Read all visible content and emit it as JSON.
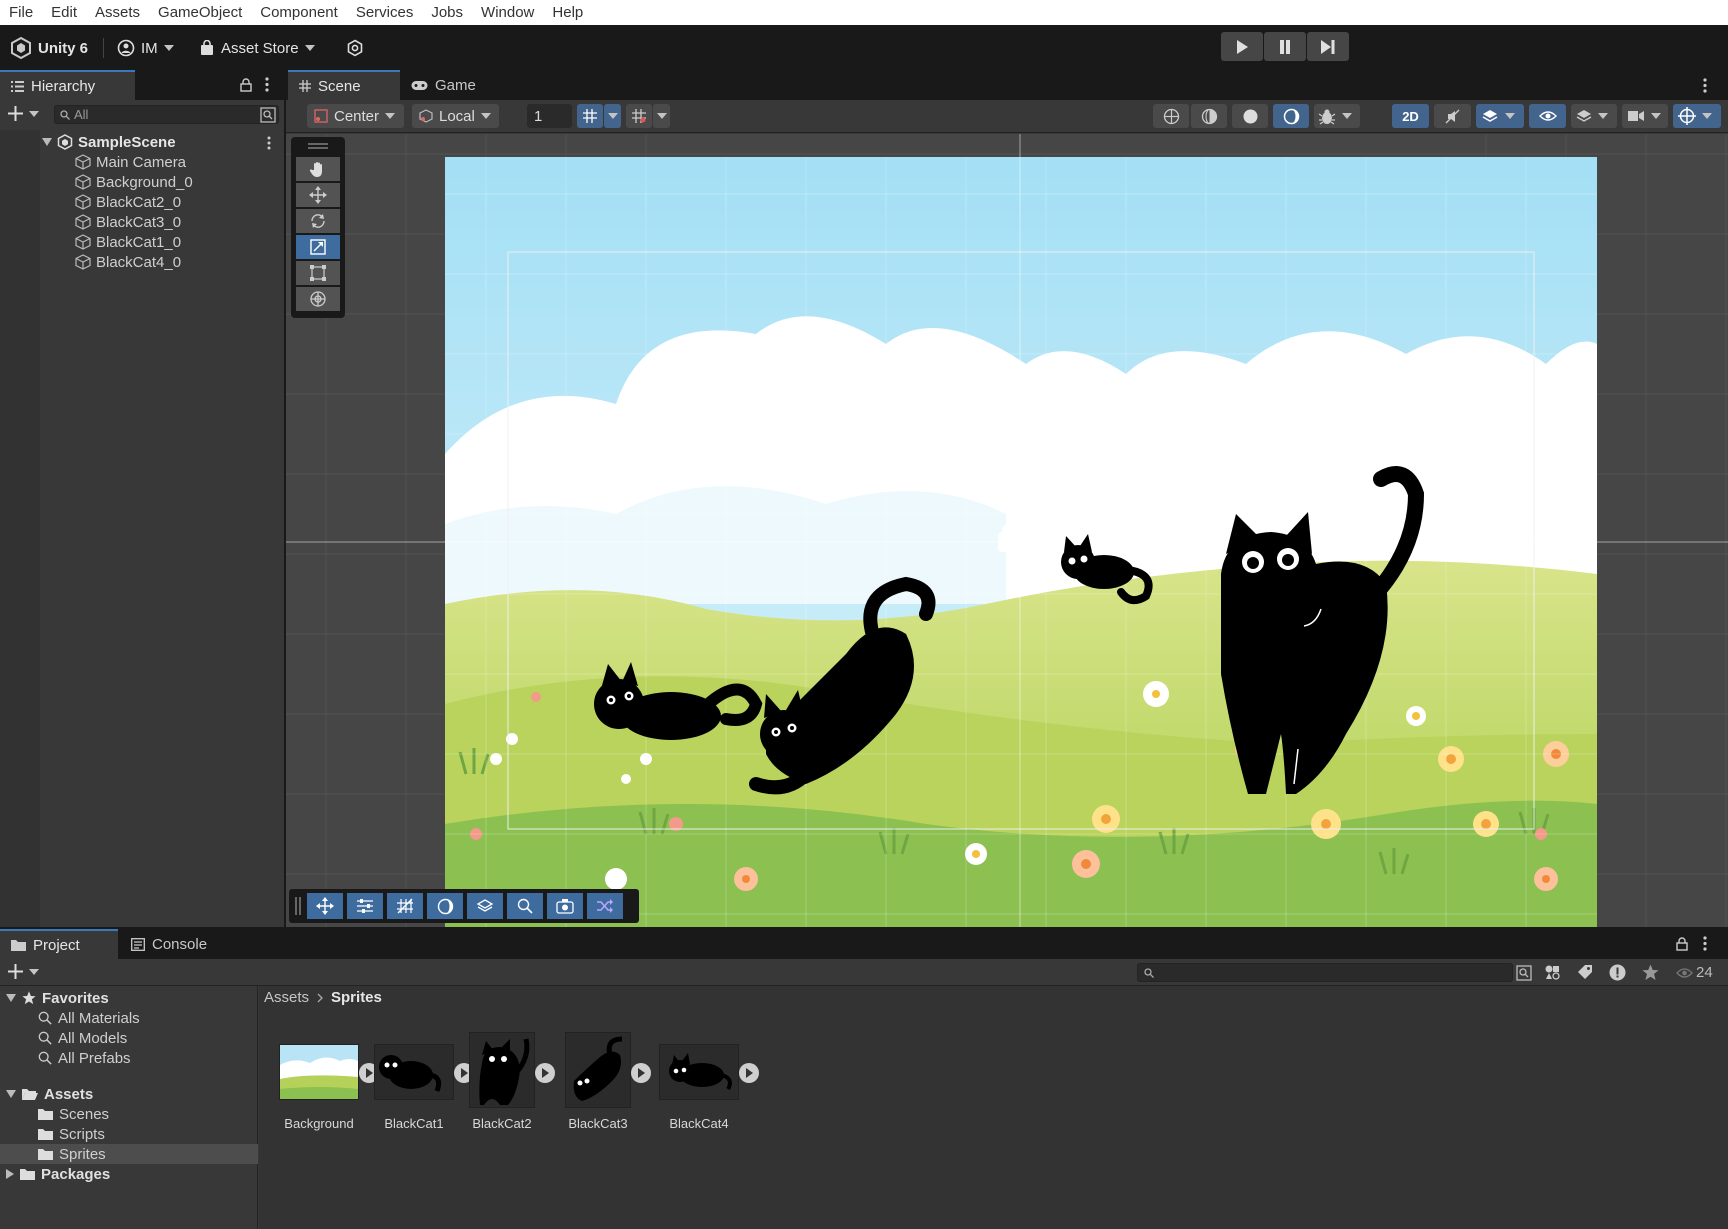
{
  "menu": [
    "File",
    "Edit",
    "Assets",
    "GameObject",
    "Component",
    "Services",
    "Jobs",
    "Window",
    "Help"
  ],
  "toolbar": {
    "unity_label": "Unity 6",
    "account_label": "IM",
    "store_label": "Asset Store"
  },
  "hierarchy": {
    "tab_label": "Hierarchy",
    "search_placeholder": "All",
    "scene_name": "SampleScene",
    "items": [
      "Main Camera",
      "Background_0",
      "BlackCat2_0",
      "BlackCat3_0",
      "BlackCat1_0",
      "BlackCat4_0"
    ]
  },
  "scene": {
    "tabs": [
      {
        "label": "Scene"
      },
      {
        "label": "Game"
      }
    ],
    "pivot_mode": "Center",
    "pivot_rotation": "Local",
    "grid_snap_value": "1",
    "mode_2d": "2D"
  },
  "project": {
    "tabs": [
      {
        "label": "Project"
      },
      {
        "label": "Console"
      }
    ],
    "visible_count": "24",
    "favorites_label": "Favorites",
    "favorites": [
      "All Materials",
      "All Models",
      "All Prefabs"
    ],
    "assets_label": "Assets",
    "folders": [
      "Scenes",
      "Scripts",
      "Sprites"
    ],
    "packages_label": "Packages",
    "breadcrumb": {
      "root": "Assets",
      "current": "Sprites"
    },
    "assets": [
      {
        "label": "Background"
      },
      {
        "label": "BlackCat1"
      },
      {
        "label": "BlackCat2"
      },
      {
        "label": "BlackCat3"
      },
      {
        "label": "BlackCat4"
      }
    ]
  },
  "colors": {
    "accent": "#3e6c9f",
    "panel": "#383838",
    "chrome": "#191919",
    "sky": "#b7e3f6",
    "grass": "#a8cc5a"
  }
}
